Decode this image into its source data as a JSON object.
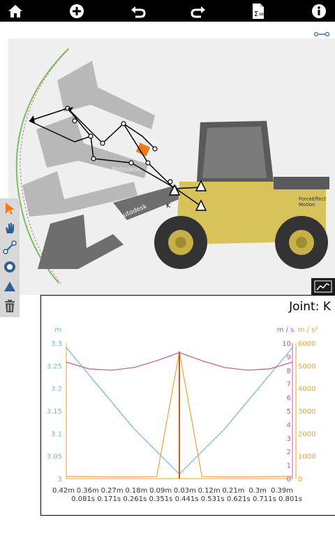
{
  "toolbar": {
    "buttons": [
      {
        "name": "home-icon"
      },
      {
        "name": "add-icon"
      },
      {
        "name": "undo-icon"
      },
      {
        "name": "redo-icon"
      },
      {
        "name": "calculator-icon"
      },
      {
        "name": "info-icon"
      }
    ]
  },
  "left_tools": [
    {
      "name": "select-tool-icon",
      "color": "#f07a18"
    },
    {
      "name": "hand-tool-icon"
    },
    {
      "name": "link-tool-icon"
    },
    {
      "name": "joint-tool-icon"
    },
    {
      "name": "ground-tool-icon"
    },
    {
      "name": "trash-icon"
    }
  ],
  "machine_labels": {
    "arm_brand_1": "Autodesk",
    "arm_brand_2": "Autodesk",
    "arm_brand_3": "Autodesk",
    "cab_brand_1": "ForceEffect",
    "cab_brand_2": "Motion",
    "joint_marker": "K"
  },
  "graph": {
    "title": "Joint: K",
    "left_unit": "m",
    "right_unit_velocity": "m / s",
    "right_unit_accel": "m / s²",
    "colors": {
      "position": "#6fb6d8",
      "velocity": "#c9548f",
      "accel": "#e8a23a",
      "spike": "#d9531e"
    },
    "chart_data": {
      "type": "line",
      "x_position_labels": [
        "0.42m",
        "0.36m",
        "0.27m",
        "0.18m",
        "0.09m",
        "0.03m",
        "0.12m",
        "0.21m",
        "0.3m",
        "0.39m"
      ],
      "x_time_labels": [
        "0.081s",
        "0.171s",
        "0.261s",
        "0.351s",
        "0.441s",
        "0.531s",
        "0.621s",
        "0.711s",
        "0.801s"
      ],
      "y_left_ticks": [
        "3.3",
        "3.25",
        "3.2",
        "3.15",
        "3.1",
        "3.05",
        "3"
      ],
      "y_velocity_ticks": [
        "10",
        "9",
        "8",
        "7",
        "6",
        "5",
        "4",
        "3",
        "2",
        "1",
        "0"
      ],
      "y_accel_ticks": [
        "6000",
        "5000",
        "4000",
        "3000",
        "2000",
        "1000",
        "0"
      ],
      "y_left_range": [
        3.0,
        3.3
      ],
      "series": [
        {
          "axis": "left",
          "values": [
            3.29,
            3.23,
            3.17,
            3.11,
            3.06,
            3.01,
            3.06,
            3.11,
            3.17,
            3.23,
            3.29
          ]
        },
        {
          "axis": "velocity",
          "values": [
            8.6,
            8.1,
            8.0,
            8.2,
            8.7,
            9.3,
            8.7,
            8.2,
            8.0,
            8.1,
            8.6
          ]
        },
        {
          "axis": "accel",
          "values": [
            100,
            90,
            80,
            80,
            90,
            5600,
            90,
            80,
            80,
            90,
            100
          ]
        }
      ]
    }
  }
}
